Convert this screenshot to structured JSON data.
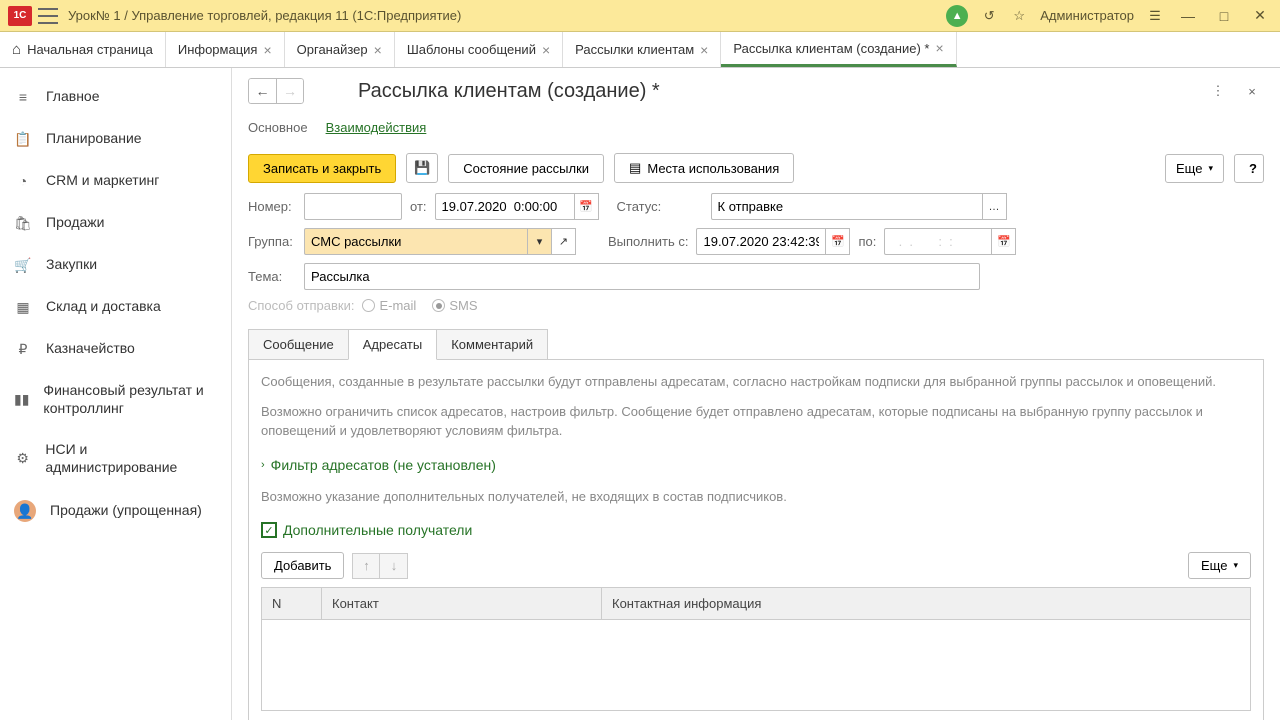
{
  "titlebar": {
    "logo": "1C",
    "title": "Урок№ 1 / Управление торговлей, редакция 11  (1С:Предприятие)",
    "user": "Администратор"
  },
  "tabs": [
    {
      "label": "Начальная страница",
      "closable": false,
      "icon": "home"
    },
    {
      "label": "Информация",
      "closable": true
    },
    {
      "label": "Органайзер",
      "closable": true
    },
    {
      "label": "Шаблоны сообщений",
      "closable": true
    },
    {
      "label": "Рассылки клиентам",
      "closable": true
    },
    {
      "label": "Рассылка клиентам (создание) *",
      "closable": true,
      "active": true
    }
  ],
  "sidebar": [
    {
      "label": "Главное",
      "icon": "menu"
    },
    {
      "label": "Планирование",
      "icon": "calendar"
    },
    {
      "label": "CRM и маркетинг",
      "icon": "pie"
    },
    {
      "label": "Продажи",
      "icon": "cart"
    },
    {
      "label": "Закупки",
      "icon": "basket"
    },
    {
      "label": "Склад и доставка",
      "icon": "grid"
    },
    {
      "label": "Казначейство",
      "icon": "ruble"
    },
    {
      "label": "Финансовый результат и контроллинг",
      "icon": "bars"
    },
    {
      "label": "НСИ и администрирование",
      "icon": "gear"
    },
    {
      "label": "Продажи (упрощенная)",
      "icon": "avatar"
    }
  ],
  "page": {
    "title": "Рассылка клиентам (создание) *",
    "inner_tabs": {
      "main": "Основное",
      "interactions": "Взаимодействия"
    },
    "toolbar": {
      "save_close": "Записать и закрыть",
      "status": "Состояние рассылки",
      "usage": "Места использования",
      "more": "Еще",
      "help": "?"
    },
    "form": {
      "number_label": "Номер:",
      "number_value": "",
      "from_label": "от:",
      "from_value": "19.07.2020  0:00:00",
      "status_label": "Статус:",
      "status_value": "К отправке",
      "group_label": "Группа:",
      "group_value": "СМС рассылки",
      "exec_from_label": "Выполнить с:",
      "exec_from_value": "19.07.2020 23:42:39",
      "to_label": "по:",
      "to_value": "  .  .       :  :  ",
      "subject_label": "Тема:",
      "subject_value": "Рассылка",
      "send_method_label": "Способ отправки:",
      "email": "E-mail",
      "sms": "SMS"
    },
    "sub_tabs": {
      "message": "Сообщение",
      "recipients": "Адресаты",
      "comment": "Комментарий"
    },
    "info1": "Сообщения, созданные в результате рассылки будут отправлены адресатам, согласно настройкам подписки для выбранной группы рассылок и оповещений.",
    "info2": "Возможно ограничить список адресатов, настроив фильтр. Сообщение будет отправлено адресатам, которые подписаны на выбранную группу рассылок и оповещений и удовлетворяют условиям фильтра.",
    "filter_label": "Фильтр адресатов (не установлен)",
    "info3": "Возможно указание дополнительных получателей, не входящих в состав подписчиков.",
    "additional_label": "Дополнительные получатели",
    "add_btn": "Добавить",
    "more2": "Еще",
    "table": {
      "col_n": "N",
      "col_contact": "Контакт",
      "col_info": "Контактная информация"
    }
  }
}
